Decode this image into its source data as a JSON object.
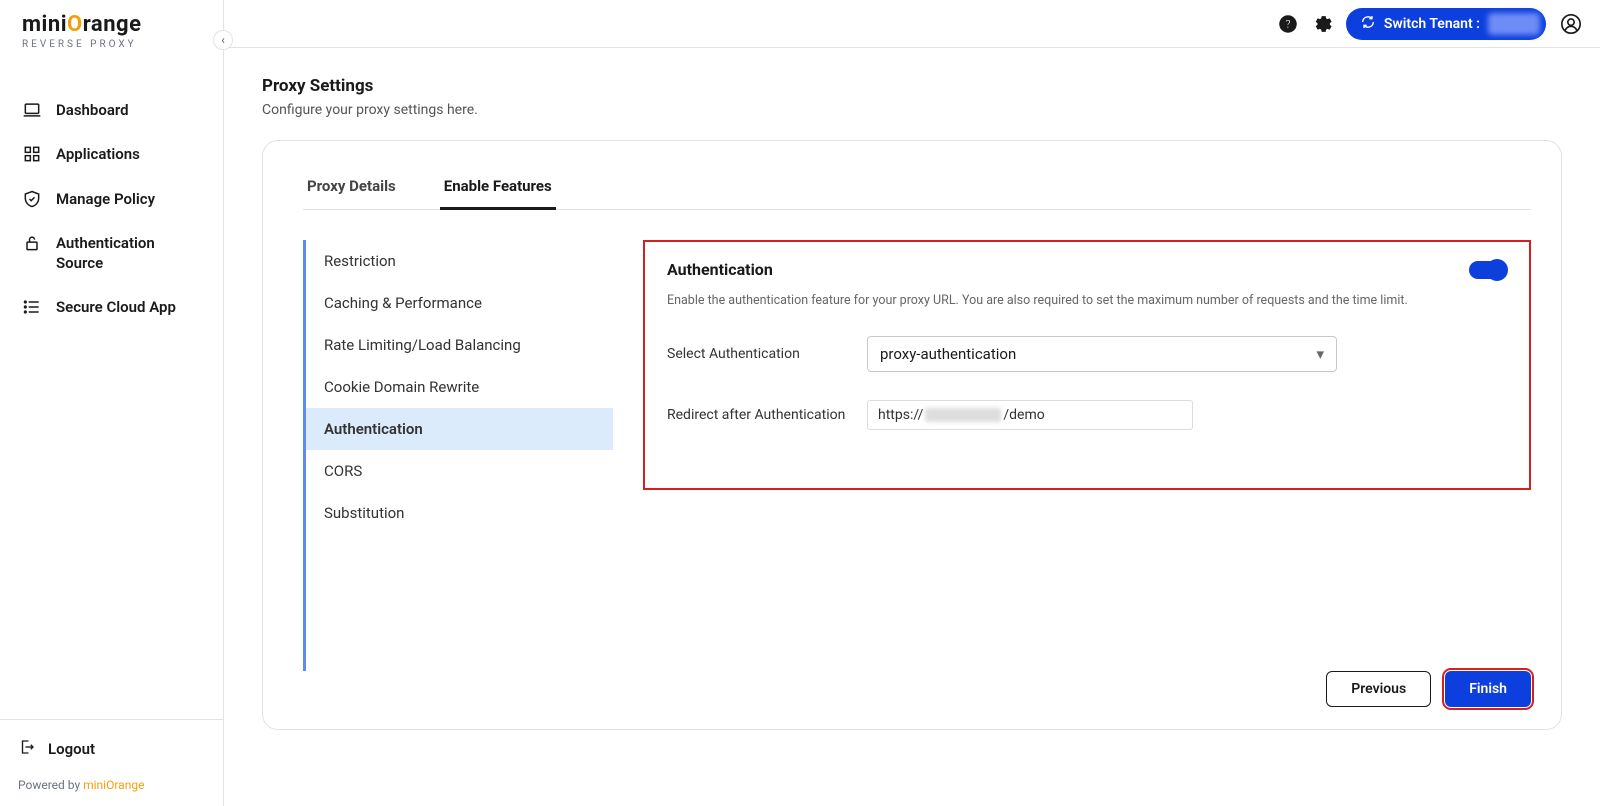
{
  "brand": {
    "name_pre": "mini",
    "name_o": "O",
    "name_post": "range",
    "tagline": "REVERSE PROXY",
    "powered_pre": "Powered by ",
    "powered_link": "miniOrange"
  },
  "sidebar": {
    "items": [
      {
        "label": "Dashboard"
      },
      {
        "label": "Applications"
      },
      {
        "label": "Manage Policy"
      },
      {
        "label": "Authentication Source"
      },
      {
        "label": "Secure Cloud App"
      }
    ],
    "logout": "Logout"
  },
  "topbar": {
    "switch": "Switch Tenant :"
  },
  "page": {
    "title": "Proxy Settings",
    "subtitle": "Configure your proxy settings here."
  },
  "tabs": {
    "proxy": "Proxy Details",
    "features": "Enable Features"
  },
  "featureNav": [
    {
      "label": "Restriction"
    },
    {
      "label": "Caching & Performance"
    },
    {
      "label": "Rate Limiting/Load Balancing"
    },
    {
      "label": "Cookie Domain Rewrite"
    },
    {
      "label": "Authentication"
    },
    {
      "label": "CORS"
    },
    {
      "label": "Substitution"
    }
  ],
  "panel": {
    "title": "Authentication",
    "desc": "Enable the authentication feature for your proxy URL. You are also required to set the maximum number of requests and the time limit.",
    "selectLabel": "Select Authentication",
    "selectValue": "proxy-authentication",
    "redirectLabel": "Redirect after Authentication",
    "redirectPre": "https://",
    "redirectPost": "/demo"
  },
  "buttons": {
    "previous": "Previous",
    "finish": "Finish"
  }
}
